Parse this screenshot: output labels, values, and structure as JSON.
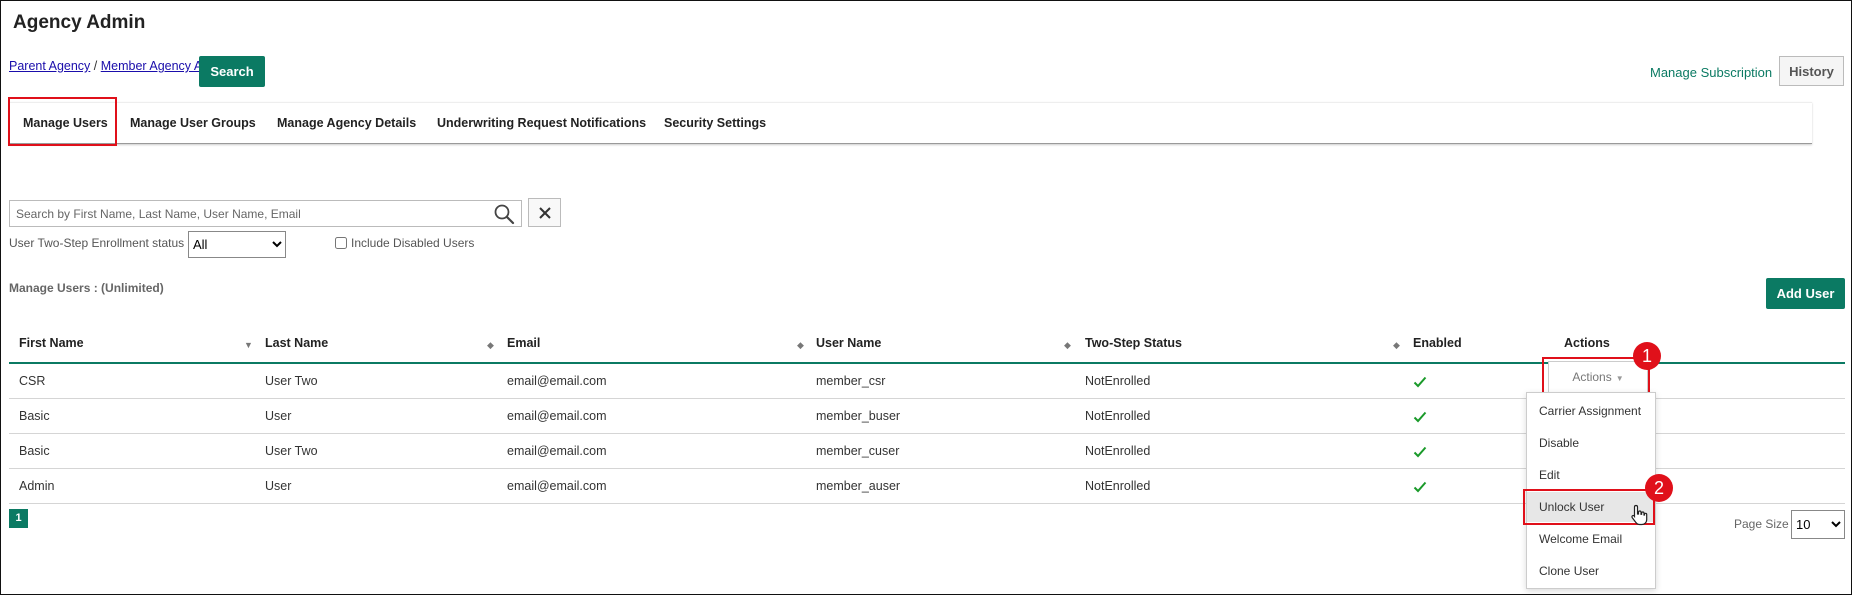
{
  "header": {
    "title": "Agency Admin",
    "breadcrumb": {
      "parent": "Parent Agency",
      "separator": " / ",
      "member": "Member Agency A"
    },
    "search_label": "Search",
    "manage_subscription": "Manage Subscription",
    "history_label": "History"
  },
  "tabs": [
    {
      "label": "Manage Users"
    },
    {
      "label": "Manage User Groups"
    },
    {
      "label": "Manage Agency Details"
    },
    {
      "label": "Underwriting Request Notifications"
    },
    {
      "label": "Security Settings"
    }
  ],
  "filters": {
    "search_placeholder": "Search by First Name, Last Name, User Name, Email",
    "enrollment_label": "User Two-Step Enrollment status",
    "enrollment_value": "All",
    "include_disabled_label": "Include Disabled Users"
  },
  "users_section": {
    "title": "Manage Users : (Unlimited)",
    "add_user_label": "Add User"
  },
  "table": {
    "columns": [
      "First Name",
      "Last Name",
      "Email",
      "User Name",
      "Two-Step Status",
      "Enabled",
      "Actions"
    ],
    "rows": [
      {
        "first": "CSR",
        "last": "User Two",
        "email": "email@email.com",
        "username": "member_csr",
        "two_step": "NotEnrolled",
        "enabled": true
      },
      {
        "first": "Basic",
        "last": "User",
        "email": "email@email.com",
        "username": "member_buser",
        "two_step": "NotEnrolled",
        "enabled": true
      },
      {
        "first": "Basic",
        "last": "User Two",
        "email": "email@email.com",
        "username": "member_cuser",
        "two_step": "NotEnrolled",
        "enabled": true
      },
      {
        "first": "Admin",
        "last": "User",
        "email": "email@email.com",
        "username": "member_auser",
        "two_step": "NotEnrolled",
        "enabled": true
      }
    ]
  },
  "actions_menu": {
    "button_label": "Actions",
    "items": [
      "Carrier Assignment",
      "Disable",
      "Edit",
      "Unlock User",
      "Welcome Email",
      "Clone User"
    ],
    "highlighted": "Unlock User"
  },
  "annotations": {
    "step1": "1",
    "step2": "2"
  },
  "pagination": {
    "current_page": "1",
    "page_size_label": "Page Size",
    "page_size_value": "10"
  },
  "colors": {
    "brand_green": "#0b7a63",
    "highlight_red": "#e0101a",
    "check_green": "#1a9a2a"
  }
}
